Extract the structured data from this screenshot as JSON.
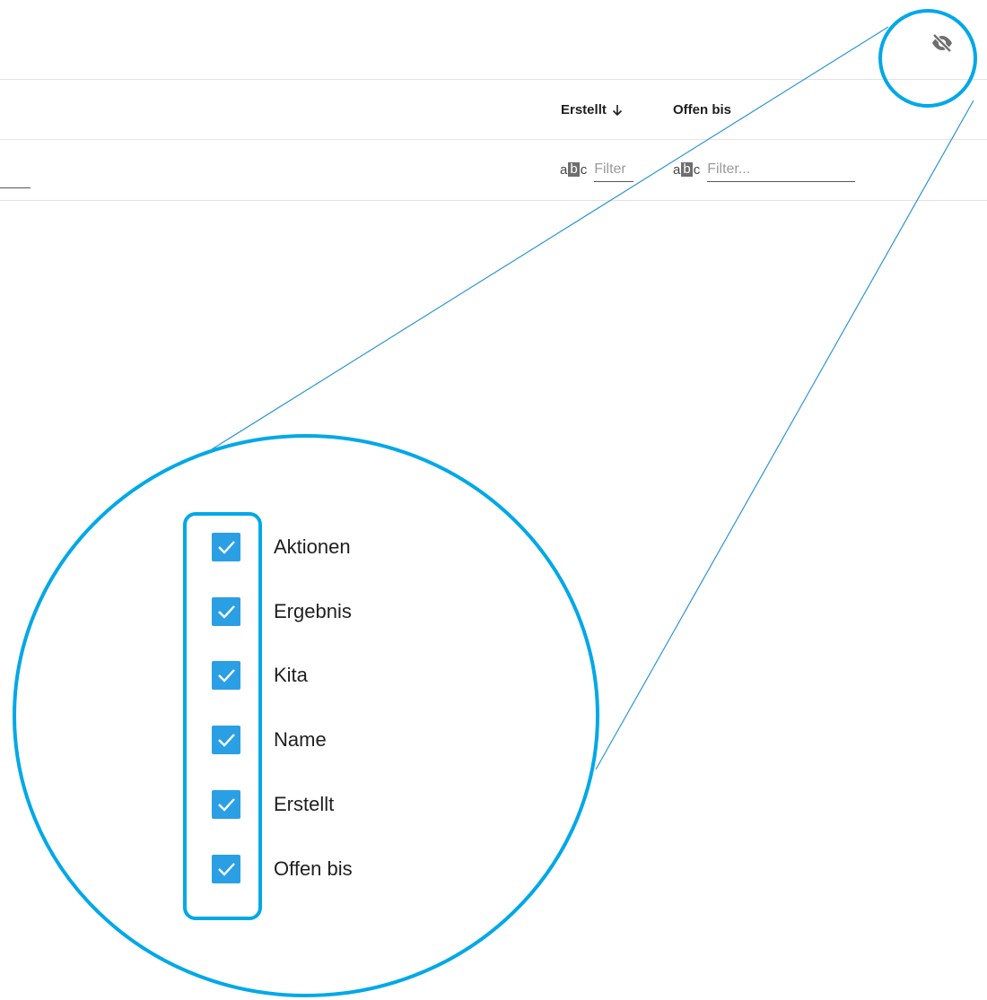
{
  "table": {
    "headers": [
      {
        "label": "Erstellt",
        "sort": "descending"
      },
      {
        "label": "Offen bis"
      }
    ],
    "filters": [
      {
        "placeholder": "Filter"
      },
      {
        "placeholder": "Filter..."
      }
    ]
  },
  "column_toggle": {
    "icon": "eye-off-icon"
  },
  "column_visibility": {
    "items": [
      {
        "label": "Aktionen",
        "checked": true
      },
      {
        "label": "Ergebnis",
        "checked": true
      },
      {
        "label": "Kita",
        "checked": true
      },
      {
        "label": "Name",
        "checked": true
      },
      {
        "label": "Erstellt",
        "checked": true
      },
      {
        "label": "Offen bis",
        "checked": true
      }
    ]
  },
  "colors": {
    "callout": "#00a8e8",
    "checkbox": "#2b9fe3"
  }
}
